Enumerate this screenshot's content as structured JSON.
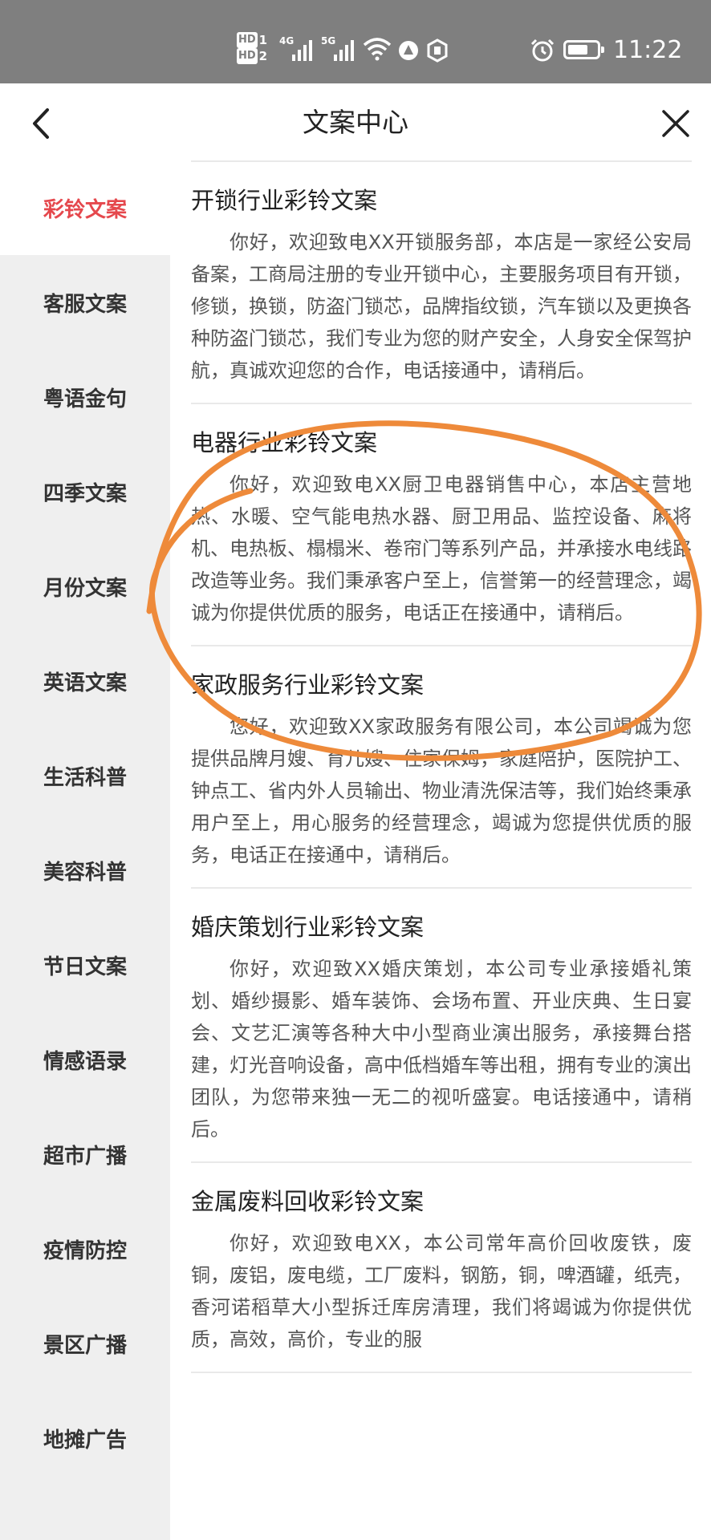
{
  "status_bar": {
    "hd1": "HD",
    "hd1_num": "1",
    "hd2": "HD",
    "hd2_num": "2",
    "net1": "4G",
    "net2": "5G",
    "time": "11:22",
    "battery_level": 0.7,
    "icons": [
      "wifi-icon",
      "hotspot-icon",
      "nfc-icon",
      "alarm-icon",
      "battery-icon"
    ]
  },
  "nav": {
    "title": "文案中心",
    "back_icon": "chevron-left-icon",
    "close_icon": "close-icon"
  },
  "sidebar": {
    "items": [
      {
        "label": "彩铃文案",
        "active": true
      },
      {
        "label": "客服文案",
        "active": false
      },
      {
        "label": "粤语金句",
        "active": false
      },
      {
        "label": "四季文案",
        "active": false
      },
      {
        "label": "月份文案",
        "active": false
      },
      {
        "label": "英语文案",
        "active": false
      },
      {
        "label": "生活科普",
        "active": false
      },
      {
        "label": "美容科普",
        "active": false
      },
      {
        "label": "节日文案",
        "active": false
      },
      {
        "label": "情感语录",
        "active": false
      },
      {
        "label": "超市广播",
        "active": false
      },
      {
        "label": "疫情防控",
        "active": false
      },
      {
        "label": "景区广播",
        "active": false
      },
      {
        "label": "地摊广告",
        "active": false
      }
    ],
    "active_color": "#e5484d"
  },
  "cards": [
    {
      "title": "开锁行业彩铃文案",
      "body": "你好，欢迎致电XX开锁服务部，本店是一家经公安局备案，工商局注册的专业开锁中心，主要服务项目有开锁，修锁，换锁，防盗门锁芯，品牌指纹锁，汽车锁以及更换各种防盗门锁芯，我们专业为您的财产安全，人身安全保驾护航，真诚欢迎您的合作，电话接通中，请稍后。"
    },
    {
      "title": "电器行业彩铃文案",
      "body": "你好，欢迎致电XX厨卫电器销售中心，本店主营地热、水暖、空气能电热水器、厨卫用品、监控设备、麻将机、电热板、榻榻米、卷帘门等系列产品，并承接水电线路改造等业务。我们秉承客户至上，信誉第一的经营理念，竭诚为你提供优质的服务，电话正在接通中，请稍后。"
    },
    {
      "title": "家政服务行业彩铃文案",
      "body": "您好，欢迎致XX家政服务有限公司，本公司竭诚为您提供品牌月嫂、育儿嫂、住家保姆，家庭陪护，医院护工、钟点工、省内外人员输出、物业清洗保洁等，我们始终秉承用户至上，用心服务的经营理念，竭诚为您提供优质的服务，电话正在接通中，请稍后。"
    },
    {
      "title": "婚庆策划行业彩铃文案",
      "body": "你好，欢迎致XX婚庆策划，本公司专业承接婚礼策划、婚纱摄影、婚车装饰、会场布置、开业庆典、生日宴会、文艺汇演等各种大中小型商业演出服务，承接舞台搭建，灯光音响设备，高中低档婚车等出租，拥有专业的演出团队，为您带来独一无二的视听盛宴。电话接通中，请稍后。"
    },
    {
      "title": "金属废料回收彩铃文案",
      "body": "你好，欢迎致电XX，本公司常年高价回收废铁，废铜，废铝，废电缆，工厂废料，钢筋，铜，啤酒罐，纸壳，香河诺稻草大小型拆迁库房清理，我们将竭诚为你提供优质，高效，高价，专业的服"
    }
  ],
  "annotation": {
    "color": "#ee8a3a",
    "shape": "hand-drawn-ellipse"
  }
}
